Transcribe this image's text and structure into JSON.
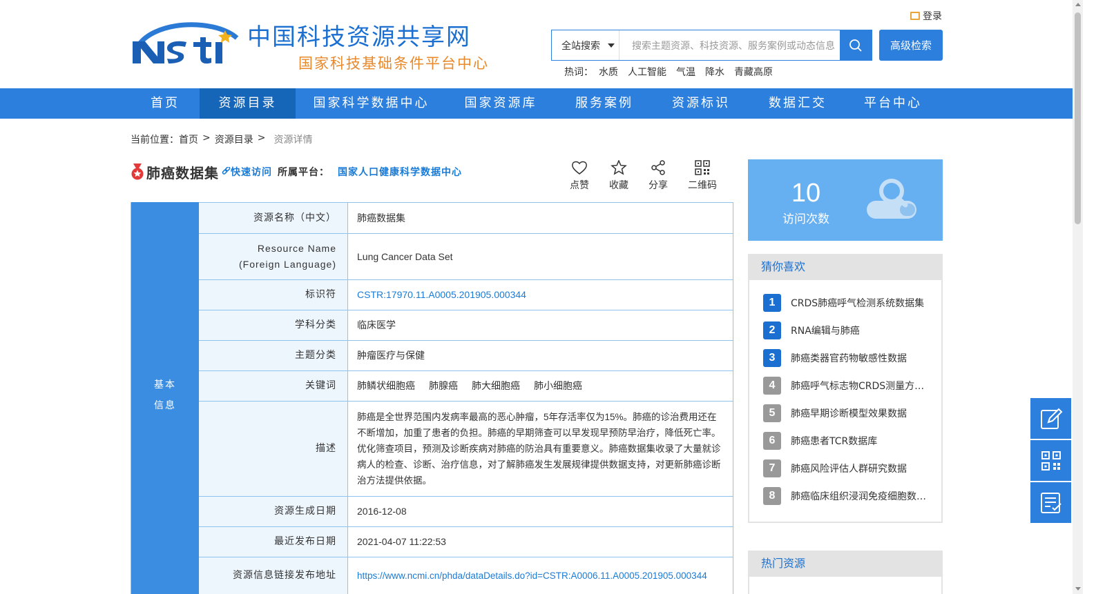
{
  "header": {
    "site_title": "中国科技资源共享网",
    "site_subtitle": "国家科技基础条件平台中心",
    "login_label": "登录",
    "search": {
      "scope": "全站搜索",
      "placeholder": "搜索主题资源、科技资源、服务案例或动态信息",
      "advanced_label": "高级检索"
    },
    "hot": {
      "label": "热词：",
      "words": [
        "水质",
        "人工智能",
        "气温",
        "降水",
        "青藏高原"
      ]
    }
  },
  "nav": {
    "items": [
      "首页",
      "资源目录",
      "国家科学数据中心",
      "国家资源库",
      "服务案例",
      "资源标识",
      "数据汇交",
      "平台中心"
    ],
    "active_index": 1
  },
  "breadcrumb": {
    "label": "当前位置：",
    "items": [
      "首页",
      ">",
      "资源目录",
      ">"
    ],
    "current": "资源详情"
  },
  "resource": {
    "title": "肺癌数据集",
    "quick_access": "快速访问",
    "platform_label": "所属平台：",
    "platform": "国家人口健康科学数据中心"
  },
  "actions": [
    "点赞",
    "收藏",
    "分享",
    "二维码"
  ],
  "info": {
    "section_label": [
      "基本",
      "信息"
    ],
    "rows": [
      {
        "key": "资源名称（中文）",
        "value": "肺癌数据集"
      },
      {
        "key": "Resource Name (Foreign Language)",
        "value": "Lung Cancer Data Set"
      },
      {
        "key": "标识符",
        "value": "CSTR:17970.11.A0005.201905.000344"
      },
      {
        "key": "学科分类",
        "value": "临床医学"
      },
      {
        "key": "主题分类",
        "value": "肿瘤医疗与保健"
      },
      {
        "key": "关键词",
        "keywords": [
          "肺鳞状细胞癌",
          "肺腺癌",
          "肺大细胞癌",
          "肺小细胞癌"
        ]
      },
      {
        "key": "描述",
        "value": "肺癌是全世界范围内发病率最高的恶心肿瘤，5年存活率仅为15%。肺癌的诊治费用还在不断增加，加重了患者的负担。肺癌的早期筛查可以早发现早预防早治疗，降低死亡率。优化筛查项目，预测及诊断疾病对肺癌的防治具有重要意义。肺癌数据集收录了大量就诊病人的检查、诊断、治疗信息，对了解肺癌发生发展规律提供数据支持，对更新肺癌诊断治方法提供依据。"
      },
      {
        "key": "资源生成日期",
        "value": "2016-12-08"
      },
      {
        "key": "最近发布日期",
        "value": "2021-04-07 11:22:53"
      },
      {
        "key": "资源信息链接发布地址",
        "value": "https://www.ncmi.cn/phda/dataDetails.do?id=CSTR:A0006.11.A0005.201905.000344"
      }
    ]
  },
  "visits": {
    "count": "10",
    "label": "访问次数"
  },
  "guess": {
    "title": "猜你喜欢",
    "items": [
      "CRDS肺癌呼气检测系统数据集",
      "RNA编辑与肺癌",
      "肺癌类器官药物敏感性数据",
      "肺癌呼气标志物CRDS测量方法研究数据集",
      "肺癌早期诊断模型效果数据",
      "肺癌患者TCR数据库",
      "肺癌风险评估人群研究数据",
      "肺癌临床组织浸润免疫细胞数据集"
    ]
  },
  "hot_resources": {
    "title": "热门资源"
  },
  "colors": {
    "primary": "#2c7fdc",
    "nav_active": "#1565b9",
    "link": "#1a7bd6",
    "accent_orange": "#e8892b",
    "top3_badge": "#1a6fd1",
    "other_badge": "#999999"
  }
}
